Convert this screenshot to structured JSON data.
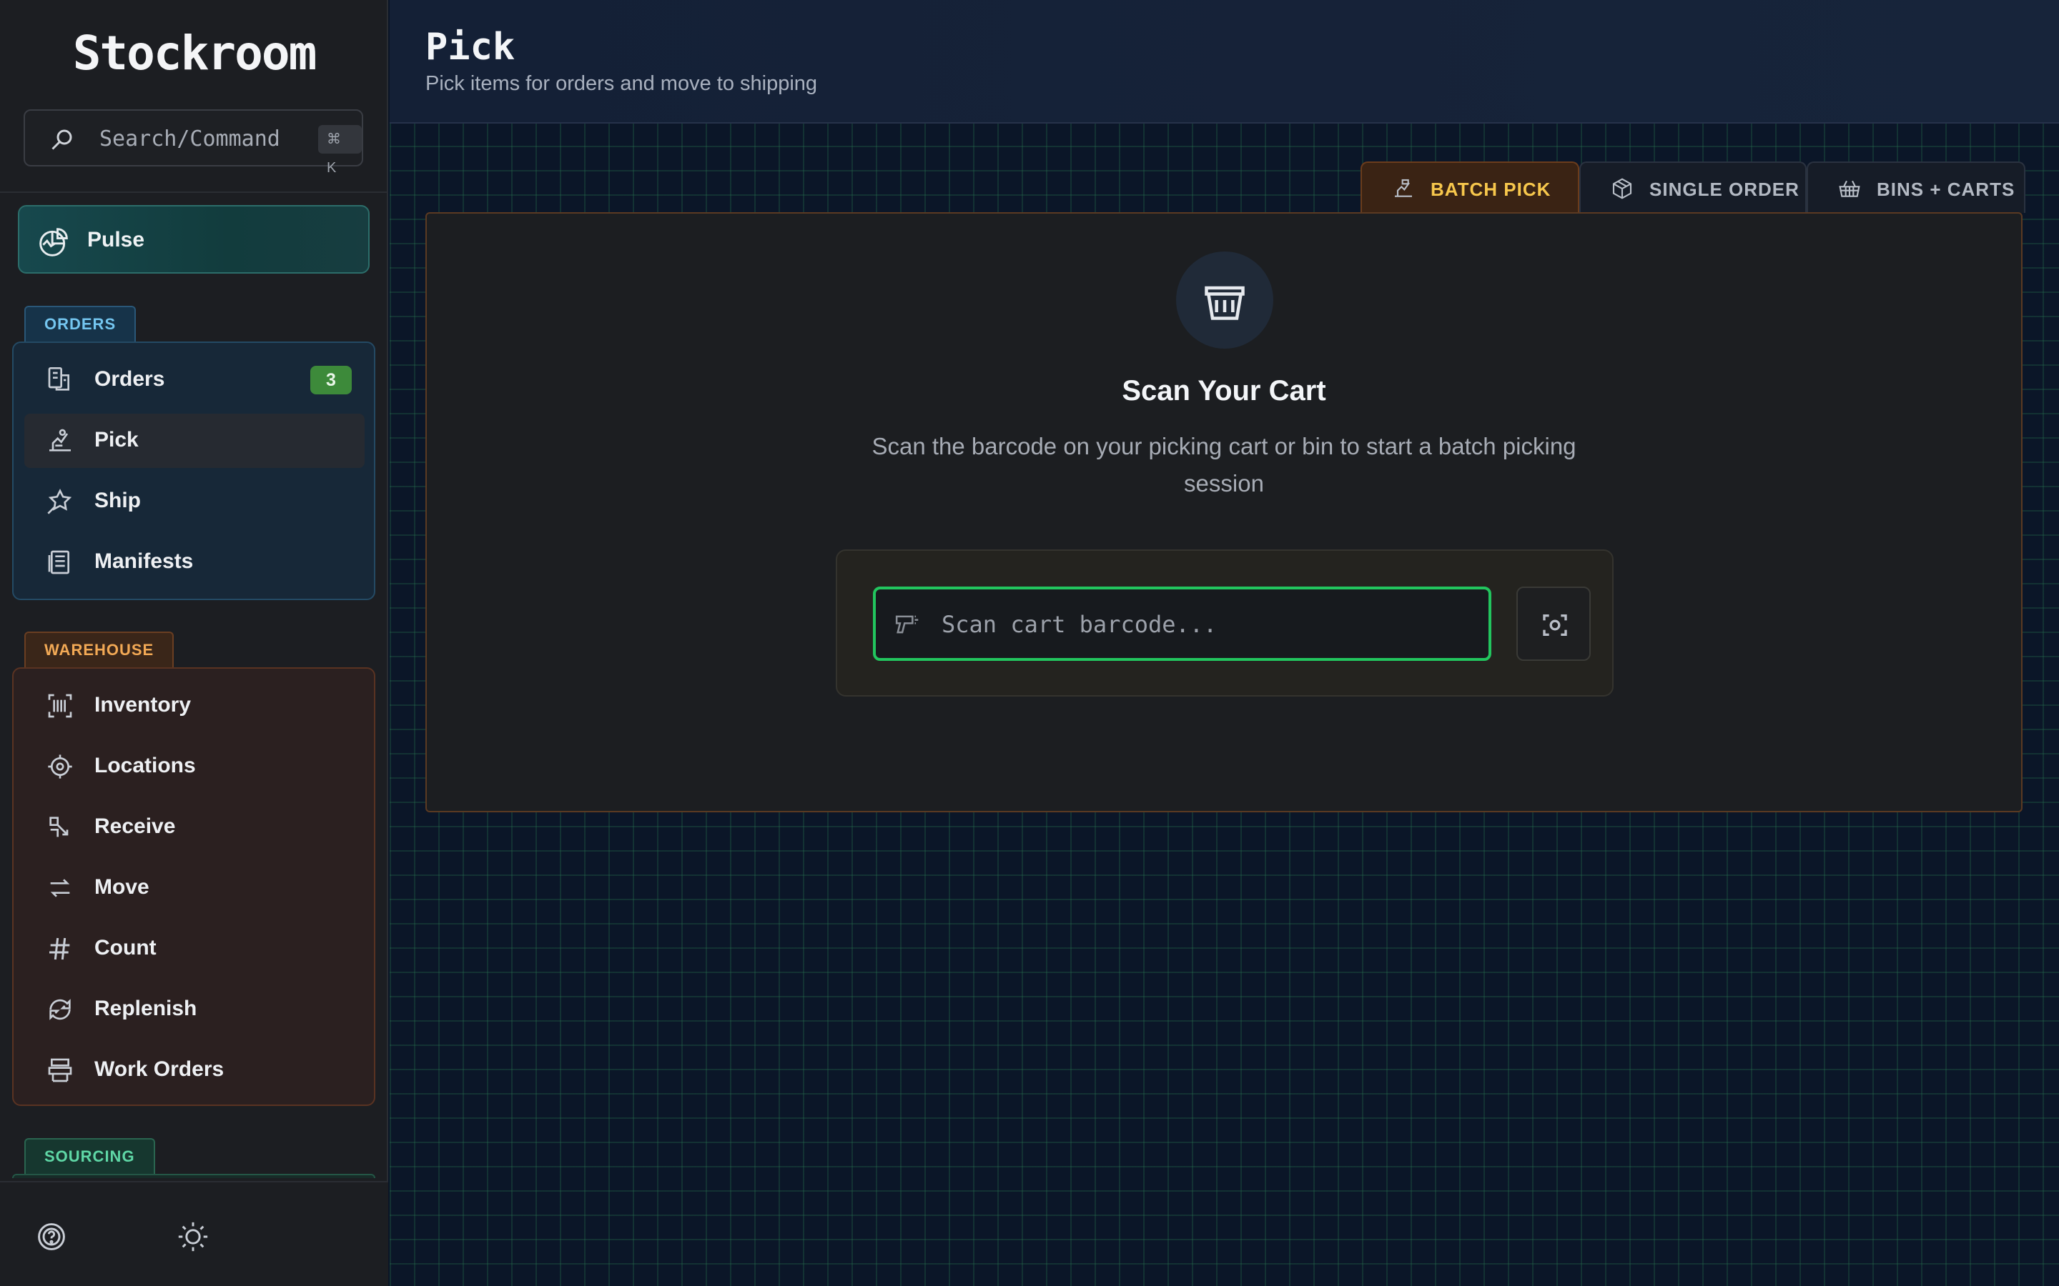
{
  "app": {
    "brand": "Stockroom",
    "search": {
      "placeholder": "Search/Command",
      "shortcut": "⌘ K"
    }
  },
  "sidebar": {
    "pulse": {
      "label": "Pulse",
      "icon": "pulse-chart-icon"
    },
    "sections": {
      "orders": {
        "label": "ORDERS",
        "items": [
          {
            "label": "Orders",
            "icon": "orders-icon",
            "badge": "3"
          },
          {
            "label": "Pick",
            "icon": "pick-icon",
            "active": true
          },
          {
            "label": "Ship",
            "icon": "ship-icon"
          },
          {
            "label": "Manifests",
            "icon": "manifest-icon"
          }
        ]
      },
      "warehouse": {
        "label": "WAREHOUSE",
        "items": [
          {
            "label": "Inventory",
            "icon": "barcode-scan-icon"
          },
          {
            "label": "Locations",
            "icon": "location-target-icon"
          },
          {
            "label": "Receive",
            "icon": "receive-icon"
          },
          {
            "label": "Move",
            "icon": "move-arrows-icon"
          },
          {
            "label": "Count",
            "icon": "hash-icon"
          },
          {
            "label": "Replenish",
            "icon": "replenish-icon"
          },
          {
            "label": "Work Orders",
            "icon": "work-orders-icon"
          }
        ]
      },
      "sourcing": {
        "label": "SOURCING"
      }
    },
    "footer": {
      "help_icon": "help-icon",
      "theme_icon": "sun-icon"
    }
  },
  "header": {
    "title": "Pick",
    "subtitle": "Pick items for orders and move to shipping"
  },
  "tabs": [
    {
      "label": "BATCH PICK",
      "icon": "batch-pick-icon",
      "active": true
    },
    {
      "label": "SINGLE ORDER",
      "icon": "box-icon"
    },
    {
      "label": "BINS + CARTS",
      "icon": "basket-icon"
    }
  ],
  "panel": {
    "icon": "basket-icon",
    "title": "Scan Your Cart",
    "description": "Scan the barcode on your picking cart or bin to start a batch picking session",
    "scan": {
      "placeholder": "Scan cart barcode...",
      "value": ""
    }
  },
  "colors": {
    "accent_green": "#22c55e",
    "tab_active_text": "#f7c74c",
    "orders_tag": "#74c6f0",
    "warehouse_tag": "#f2a955",
    "sourcing_tag": "#5fd7a6",
    "badge": "#3d8a3a"
  }
}
